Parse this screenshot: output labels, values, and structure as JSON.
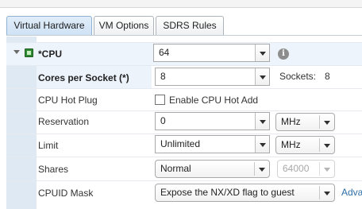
{
  "tabs": [
    {
      "label": "Virtual Hardware",
      "active": true
    },
    {
      "label": "VM Options",
      "active": false
    },
    {
      "label": "SDRS Rules",
      "active": false
    }
  ],
  "cpu": {
    "label": "*CPU",
    "value": "64",
    "info_icon": "info-icon",
    "expander_icon": "expand-triangle-icon",
    "device_icon": "cpu-chip-icon"
  },
  "cores_per_socket": {
    "label": "Cores per Socket (*)",
    "value": "8",
    "sockets_label": "Sockets:",
    "sockets_value": "8"
  },
  "hot_plug": {
    "label": "CPU Hot Plug",
    "checkbox_label": "Enable CPU Hot Add",
    "checked": false
  },
  "reservation": {
    "label": "Reservation",
    "value": "0",
    "unit": "MHz"
  },
  "limit": {
    "label": "Limit",
    "value": "Unlimited",
    "unit": "MHz"
  },
  "shares": {
    "label": "Shares",
    "value": "Normal",
    "amount": "64000"
  },
  "cpuid_mask": {
    "label": "CPUID Mask",
    "value": "Expose the NX/XD flag to guest",
    "advanced_link": "Adva"
  },
  "colors": {
    "active_tab": "#cfe2f5",
    "left_band": "#dfe9f3",
    "cpu_icon": "#2f8a34",
    "link": "#2d6fa8"
  }
}
